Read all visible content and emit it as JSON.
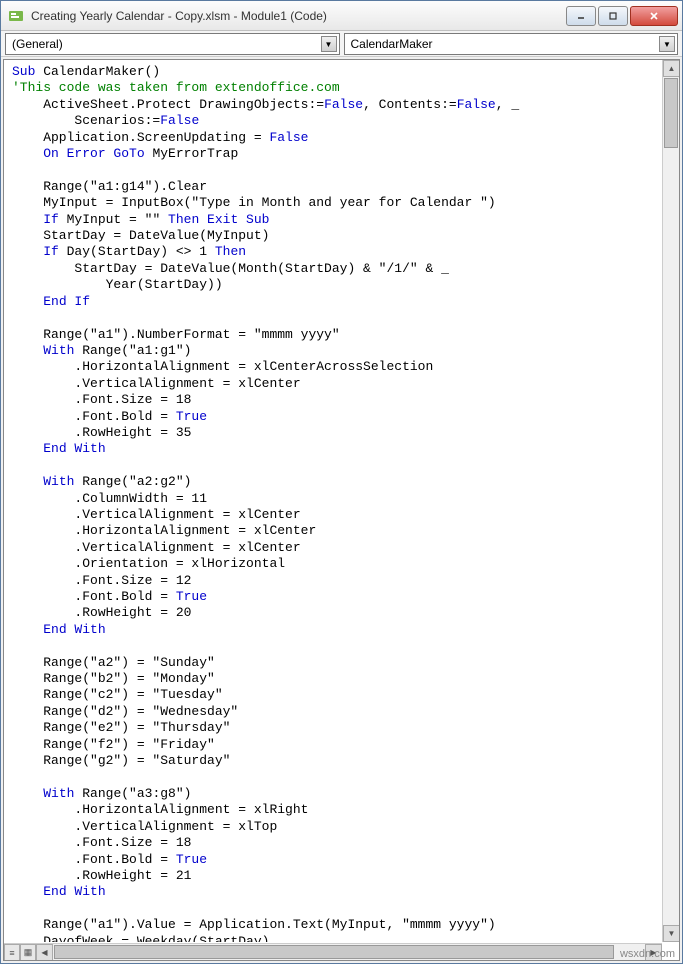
{
  "window": {
    "title": "Creating Yearly Calendar - Copy.xlsm - Module1 (Code)"
  },
  "dropdowns": {
    "left": "(General)",
    "right": "CalendarMaker"
  },
  "watermark": "wsxdn.com",
  "code": {
    "l01a": "Sub",
    "l01b": " CalendarMaker()",
    "l02": "'This code was taken from extendoffice.com",
    "l03a": "    ActiveSheet.Protect DrawingObjects:=",
    "l03b": "False",
    "l03c": ", Contents:=",
    "l03d": "False",
    "l03e": ", _",
    "l04a": "        Scenarios:=",
    "l04b": "False",
    "l05a": "    Application.ScreenUpdating = ",
    "l05b": "False",
    "l06a": "    ",
    "l06b": "On Error GoTo",
    "l06c": " MyErrorTrap",
    "l07": " ",
    "l08": "    Range(\"a1:g14\").Clear",
    "l09": "    MyInput = InputBox(\"Type in Month and year for Calendar \")",
    "l10a": "    ",
    "l10b": "If",
    "l10c": " MyInput = \"\" ",
    "l10d": "Then Exit Sub",
    "l11": "    StartDay = DateValue(MyInput)",
    "l12a": "    ",
    "l12b": "If",
    "l12c": " Day(StartDay) <> 1 ",
    "l12d": "Then",
    "l13": "        StartDay = DateValue(Month(StartDay) & \"/1/\" & _",
    "l14": "            Year(StartDay))",
    "l15a": "    ",
    "l15b": "End If",
    "l16": " ",
    "l17": "    Range(\"a1\").NumberFormat = \"mmmm yyyy\"",
    "l18a": "    ",
    "l18b": "With",
    "l18c": " Range(\"a1:g1\")",
    "l19": "        .HorizontalAlignment = xlCenterAcrossSelection",
    "l20": "        .VerticalAlignment = xlCenter",
    "l21": "        .Font.Size = 18",
    "l22a": "        .Font.Bold = ",
    "l22b": "True",
    "l23": "        .RowHeight = 35",
    "l24a": "    ",
    "l24b": "End With",
    "l25": " ",
    "l26a": "    ",
    "l26b": "With",
    "l26c": " Range(\"a2:g2\")",
    "l27": "        .ColumnWidth = 11",
    "l28": "        .VerticalAlignment = xlCenter",
    "l29": "        .HorizontalAlignment = xlCenter",
    "l30": "        .VerticalAlignment = xlCenter",
    "l31": "        .Orientation = xlHorizontal",
    "l32": "        .Font.Size = 12",
    "l33a": "        .Font.Bold = ",
    "l33b": "True",
    "l34": "        .RowHeight = 20",
    "l35a": "    ",
    "l35b": "End With",
    "l36": " ",
    "l37": "    Range(\"a2\") = \"Sunday\"",
    "l38": "    Range(\"b2\") = \"Monday\"",
    "l39": "    Range(\"c2\") = \"Tuesday\"",
    "l40": "    Range(\"d2\") = \"Wednesday\"",
    "l41": "    Range(\"e2\") = \"Thursday\"",
    "l42": "    Range(\"f2\") = \"Friday\"",
    "l43": "    Range(\"g2\") = \"Saturday\"",
    "l44": " ",
    "l45a": "    ",
    "l45b": "With",
    "l45c": " Range(\"a3:g8\")",
    "l46": "        .HorizontalAlignment = xlRight",
    "l47": "        .VerticalAlignment = xlTop",
    "l48": "        .Font.Size = 18",
    "l49a": "        .Font.Bold = ",
    "l49b": "True",
    "l50": "        .RowHeight = 21",
    "l51a": "    ",
    "l51b": "End With",
    "l52": " ",
    "l53": "    Range(\"a1\").Value = Application.Text(MyInput, \"mmmm yyyy\")",
    "l54": "    DayofWeek = Weekday(StartDay)"
  }
}
